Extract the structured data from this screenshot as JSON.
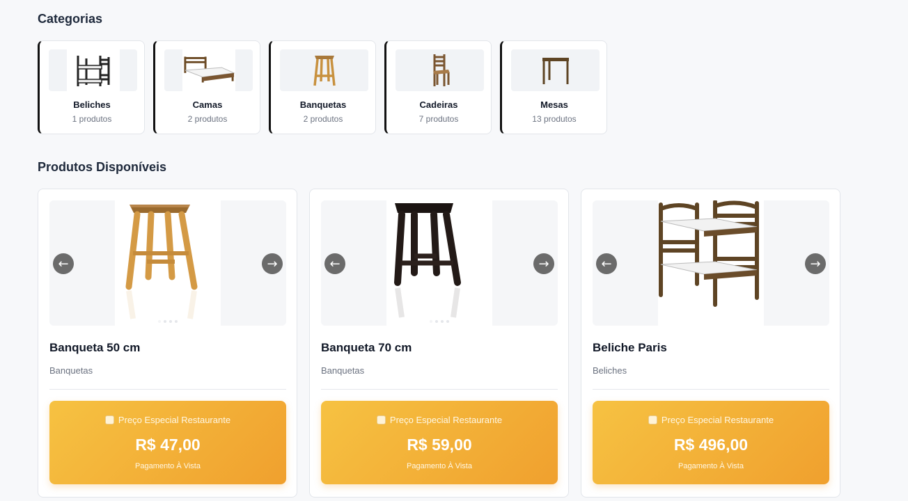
{
  "categories_title": "Categorias",
  "categories": [
    {
      "name": "Beliches",
      "count": "1 produtos",
      "icon": "bunk-bed-icon"
    },
    {
      "name": "Camas",
      "count": "2 produtos",
      "icon": "bed-icon"
    },
    {
      "name": "Banquetas",
      "count": "2 produtos",
      "icon": "stool-icon"
    },
    {
      "name": "Cadeiras",
      "count": "7 produtos",
      "icon": "chair-icon"
    },
    {
      "name": "Mesas",
      "count": "13 produtos",
      "icon": "table-icon"
    }
  ],
  "products_title": "Produtos Disponíveis",
  "products": [
    {
      "name": "Banqueta 50 cm",
      "category": "Banquetas",
      "price_label": "Preço Especial Restaurante",
      "price": "R$ 47,00",
      "payment": "Pagamento À Vista",
      "prev": "←",
      "next": "→",
      "image_icon": "light-wood-stool-icon"
    },
    {
      "name": "Banqueta 70 cm",
      "category": "Banquetas",
      "price_label": "Preço Especial Restaurante",
      "price": "R$ 59,00",
      "payment": "Pagamento À Vista",
      "prev": "←",
      "next": "→",
      "image_icon": "dark-wood-stool-icon"
    },
    {
      "name": "Beliche Paris",
      "category": "Beliches",
      "price_label": "Preço Especial Restaurante",
      "price": "R$ 496,00",
      "payment": "Pagamento À Vista",
      "prev": "←",
      "next": "→",
      "image_icon": "bunk-bed-icon"
    }
  ],
  "colors": {
    "accent": "#f0a02e",
    "accent_light": "#f6c242",
    "card_border": "#e2e5ea",
    "category_accent": "#111111"
  }
}
